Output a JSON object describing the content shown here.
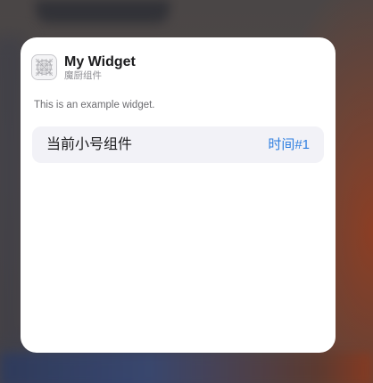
{
  "widget": {
    "title": "My Widget",
    "subtitle": "魔厨组件",
    "description": "This is an example widget.",
    "app_icon": "grid-widget-icon"
  },
  "size_row": {
    "label": "当前小号组件",
    "value": "时间#1"
  },
  "colors": {
    "card_bg": "#ffffff",
    "row_bg": "#f2f2f7",
    "accent": "#2f7fe0",
    "title_text": "#1c1c1e",
    "secondary_text": "#8e8e93"
  }
}
